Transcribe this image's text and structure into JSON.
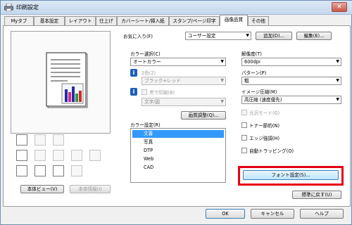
{
  "window": {
    "title": "印刷設定",
    "close_symbol": "✕"
  },
  "tabs": [
    {
      "label": "Myタブ"
    },
    {
      "label": "基本設定"
    },
    {
      "label": "レイアウト"
    },
    {
      "label": "仕上げ"
    },
    {
      "label": "カバーシート/挿入紙"
    },
    {
      "label": "スタンプ/ページ印字"
    },
    {
      "label": "画像品質",
      "active": true
    },
    {
      "label": "その他"
    }
  ],
  "left": {
    "view_button": "本体ビュー(V)",
    "info_button": "本体情報(I)"
  },
  "favorites": {
    "label": "お気に入り(F)",
    "value": "ユーザー設定",
    "add_button": "追加(D)...",
    "edit_button": "編集(E)..."
  },
  "color_select": {
    "label": "カラー選択(C)",
    "value": "オートカラー"
  },
  "two_color": {
    "label": "2色(2)",
    "value": "ブラック+レッド"
  },
  "black_print": {
    "label": "黒で印刷(B)",
    "value": "文字/図"
  },
  "quality_adjust_button": "画質調整(Q)...",
  "color_settings": {
    "label": "カラー設定(R)",
    "items": [
      "文書",
      "写真",
      "DTP",
      "Web",
      "CAD"
    ],
    "selected_index": 0
  },
  "resolution": {
    "label": "解像度(T)",
    "value": "600dpi"
  },
  "pattern": {
    "label": "パターン(P)",
    "value": "粗"
  },
  "image_compression": {
    "label": "イメージ圧縮(M)",
    "value": "高圧縮 (速度優先)"
  },
  "checkboxes": [
    {
      "label": "光沢モード(G)",
      "disabled": true
    },
    {
      "label": "トナー節約(N)",
      "disabled": false
    },
    {
      "label": "エッジ強調(H)",
      "disabled": false
    },
    {
      "label": "自動トラッピング(O)",
      "disabled": false
    }
  ],
  "font_settings_button": "フォント設定(S)...",
  "reset_button": "標準に戻す(U)",
  "footer": {
    "ok": "OK",
    "cancel": "キャンセル",
    "help": "ヘルプ"
  },
  "colors": {
    "highlight": "#e60012",
    "selection": "#3399ff",
    "info": "#1e5fb8"
  }
}
